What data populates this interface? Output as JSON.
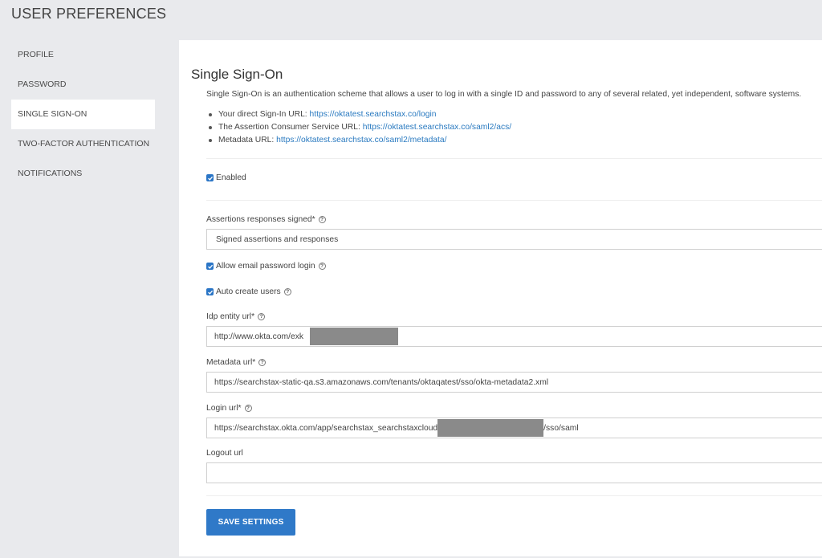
{
  "header": {
    "title": "USER PREFERENCES"
  },
  "sidebar": {
    "items": [
      {
        "label": "PROFILE"
      },
      {
        "label": "PASSWORD"
      },
      {
        "label": "SINGLE SIGN-ON"
      },
      {
        "label": "TWO-FACTOR AUTHENTICATION"
      },
      {
        "label": "NOTIFICATIONS"
      }
    ],
    "active": "SINGLE SIGN-ON"
  },
  "sso": {
    "title": "Single Sign-On",
    "description": "Single Sign-On is an authentication scheme that allows a user to log in with a single ID and password to any of several related, yet independent, software systems.",
    "urls": [
      {
        "label": "Your direct Sign-In URL:",
        "link": "https://oktatest.searchstax.co/login"
      },
      {
        "label": "The Assertion Consumer Service URL:",
        "link": "https://oktatest.searchstax.co/saml2/acs/"
      },
      {
        "label": "Metadata URL:",
        "link": "https://oktatest.searchstax.co/saml2/metadata/"
      }
    ],
    "enabled": {
      "label": "Enabled",
      "checked": true
    },
    "assertions": {
      "label": "Assertions responses signed*",
      "value": "Signed assertions and responses"
    },
    "allow_email": {
      "label": "Allow email password login",
      "checked": true
    },
    "auto_create": {
      "label": "Auto create users",
      "checked": true
    },
    "idp_entity": {
      "label": "Idp entity url*",
      "value": "http://www.okta.com/exk"
    },
    "metadata_url": {
      "label": "Metadata url*",
      "value": "https://searchstax-static-qa.s3.amazonaws.com/tenants/oktaqatest/sso/okta-metadata2.xml"
    },
    "login_url": {
      "label": "Login url*",
      "value_prefix": "https://searchstax.okta.com/app/searchstax_searchstaxcloud",
      "value_suffix": "/sso/saml"
    },
    "logout_url": {
      "label": "Logout url",
      "value": ""
    },
    "save_label": "SAVE SETTINGS"
  },
  "icons": {
    "help": "?"
  }
}
